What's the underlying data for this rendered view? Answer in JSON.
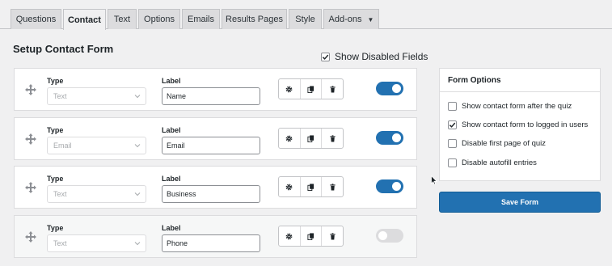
{
  "tabs": [
    {
      "label": "Questions",
      "active": false
    },
    {
      "label": "Contact",
      "active": true
    },
    {
      "label": "Text",
      "active": false
    },
    {
      "label": "Options",
      "active": false
    },
    {
      "label": "Emails",
      "active": false
    },
    {
      "label": "Results Pages",
      "active": false
    },
    {
      "label": "Style",
      "active": false
    },
    {
      "label": "Add-ons",
      "active": false,
      "icon": "caret-down-icon"
    }
  ],
  "page": {
    "heading": "Setup Contact Form",
    "show_disabled_label": "Show Disabled Fields",
    "show_disabled_checked": true
  },
  "fields": [
    {
      "type_label": "Type",
      "type_value": "Text",
      "label_label": "Label",
      "label_value": "Name",
      "enabled": true
    },
    {
      "type_label": "Type",
      "type_value": "Email",
      "label_label": "Label",
      "label_value": "Email",
      "enabled": true
    },
    {
      "type_label": "Type",
      "type_value": "Text",
      "label_label": "Label",
      "label_value": "Business",
      "enabled": true
    },
    {
      "type_label": "Type",
      "type_value": "Text",
      "label_label": "Label",
      "label_value": "Phone",
      "enabled": false
    }
  ],
  "field_actions": [
    "gear-icon",
    "duplicate-icon",
    "trash-icon"
  ],
  "form_options": {
    "title": "Form Options",
    "items": [
      {
        "label": "Show contact form after the quiz",
        "checked": false
      },
      {
        "label": "Show contact form to logged in users",
        "checked": true
      },
      {
        "label": "Disable first page of quiz",
        "checked": false
      },
      {
        "label": "Disable autofill entries",
        "checked": false
      }
    ]
  },
  "save_button": "Save Form",
  "colors": {
    "accent": "#2271b1",
    "background": "#f0f0f1",
    "toggle_off": "#dcdcde"
  }
}
